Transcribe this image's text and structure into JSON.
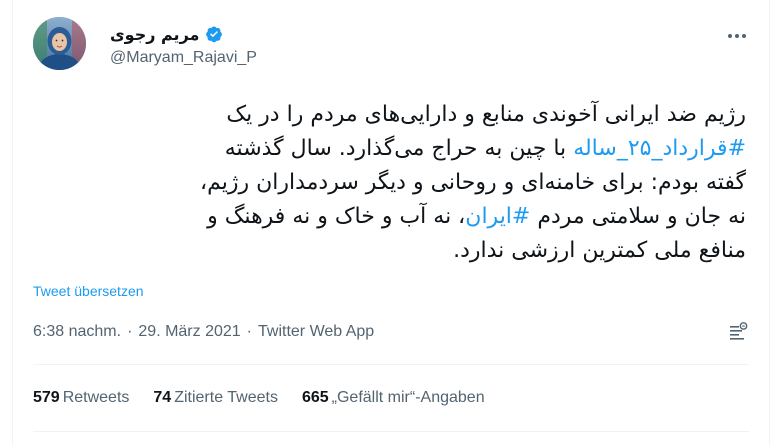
{
  "author": {
    "display_name": "مریم رجوی",
    "handle": "@Maryam_Rajavi_P",
    "verified": true,
    "avatar_icon": "profile-photo"
  },
  "tweet": {
    "lines": [
      [
        {
          "text": "رژیم ضد ایرانی آخوندی منابع و دارایی‌های مردم را در یک",
          "hashtag": false
        }
      ],
      [
        {
          "text": "#قرارداد_۲۵_ساله",
          "hashtag": true
        },
        {
          "text": " با چین به حراج می‌گذارد. سال گذشته",
          "hashtag": false
        }
      ],
      [
        {
          "text": "گفته بودم: برای خامنه‌ای و روحانی و دیگر سردمداران رژیم،",
          "hashtag": false
        }
      ],
      [
        {
          "text": "نه جان و سلامتی مردم ",
          "hashtag": false
        },
        {
          "text": "#ایران",
          "hashtag": true
        },
        {
          "text": "، نه آب و خاک و نه فرهنگ و",
          "hashtag": false
        }
      ],
      [
        {
          "text": "منافع ملی کمترین ارزشی ندارد.",
          "hashtag": false
        }
      ]
    ],
    "translate_label": "Tweet übersetzen"
  },
  "meta": {
    "time": "6:38 nachm.",
    "separator": "·",
    "date": "29. März 2021",
    "source": "Twitter Web App"
  },
  "stats": {
    "retweets_count": "579",
    "retweets_label": "Retweets",
    "quotes_count": "74",
    "quotes_label": "Zitierte Tweets",
    "likes_count": "665",
    "likes_label": "„Gefällt mir“-Angaben"
  },
  "colors": {
    "accent": "#1d9bf0",
    "text": "#0f1419",
    "secondary": "#536471",
    "divider": "#eff3f4"
  }
}
